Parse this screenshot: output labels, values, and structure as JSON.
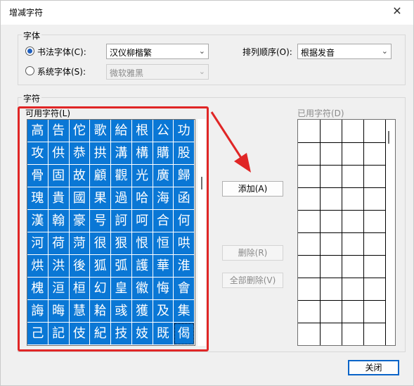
{
  "window": {
    "title": "增减字符",
    "close_glyph": "✕"
  },
  "font_group": {
    "label": "字体",
    "calligraphy_radio": {
      "label": "书法字体(C):",
      "selected": true
    },
    "calligraphy_font": "汉仪柳楷繁",
    "system_radio": {
      "label": "系统字体(S):",
      "selected": false
    },
    "system_font": "微软雅黑",
    "sort_label": "排列顺序(O):",
    "sort_value": "根据发音"
  },
  "chars_group": {
    "label": "字符",
    "available_label": "可用字符(L)",
    "used_label": "已用字符(D)",
    "available_chars": [
      [
        "高",
        "告",
        "佗",
        "歌",
        "給",
        "根",
        "公",
        "功"
      ],
      [
        "攻",
        "供",
        "恭",
        "拱",
        "溝",
        "構",
        "購",
        "股"
      ],
      [
        "骨",
        "固",
        "故",
        "顧",
        "觀",
        "光",
        "廣",
        "歸"
      ],
      [
        "瑰",
        "貴",
        "國",
        "果",
        "過",
        "哈",
        "海",
        "函"
      ],
      [
        "漢",
        "翰",
        "豪",
        "号",
        "訶",
        "呵",
        "合",
        "何"
      ],
      [
        "河",
        "荷",
        "菏",
        "很",
        "狠",
        "恨",
        "恒",
        "哄"
      ],
      [
        "烘",
        "洪",
        "後",
        "狐",
        "弧",
        "護",
        "華",
        "淮"
      ],
      [
        "槐",
        "洹",
        "桓",
        "幻",
        "皇",
        "徽",
        "悔",
        "會"
      ],
      [
        "誨",
        "晦",
        "慧",
        "耠",
        "彧",
        "獲",
        "及",
        "集"
      ],
      [
        "己",
        "記",
        "伎",
        "紀",
        "技",
        "妓",
        "既",
        "偈"
      ]
    ],
    "selected_char": "偈"
  },
  "buttons": {
    "add": "添加(A)",
    "remove": "删除(R)",
    "remove_all": "全部删除(V)",
    "close": "关闭"
  },
  "colors": {
    "cell_blue": "#0a77d5",
    "highlight_red": "#e02626"
  }
}
